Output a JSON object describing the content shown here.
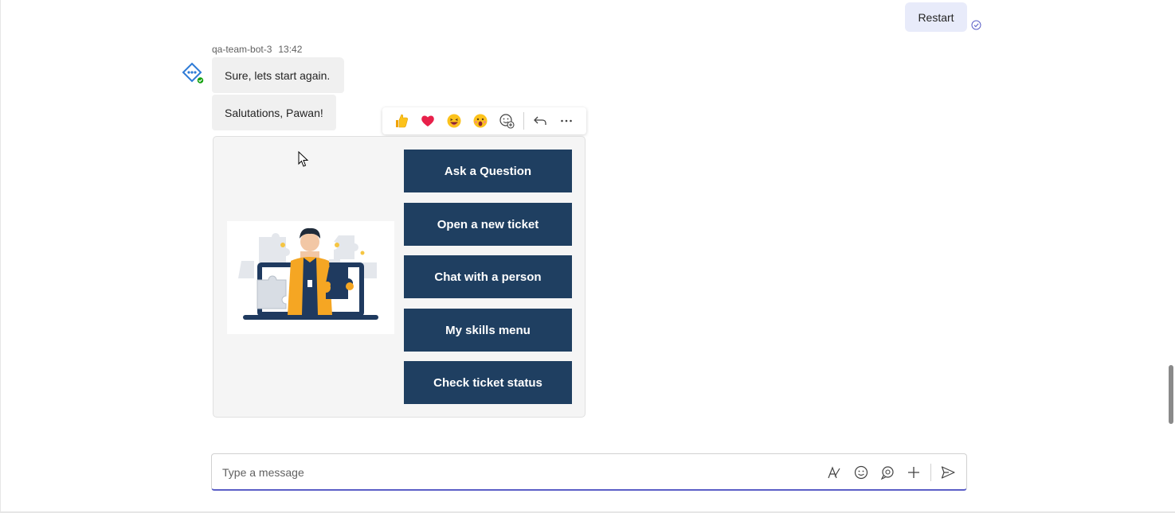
{
  "my_message": {
    "text": "Restart"
  },
  "bot_message": {
    "sender": "qa-team-bot-3",
    "time": "13:42",
    "lines": [
      "Sure, lets start again.",
      "Salutations, Pawan!"
    ]
  },
  "reactions": [
    "like",
    "heart",
    "laugh",
    "surprised",
    "add-reaction",
    "reply",
    "more-options"
  ],
  "card": {
    "buttons": [
      "Ask a Question",
      "Open a new ticket",
      "Chat with a person",
      "My skills menu",
      "Check ticket status"
    ]
  },
  "compose": {
    "placeholder": "Type a message"
  },
  "colors": {
    "card_button": "#1f3f61",
    "accent": "#5b5fc7",
    "my_bubble": "#e8ebfa"
  }
}
